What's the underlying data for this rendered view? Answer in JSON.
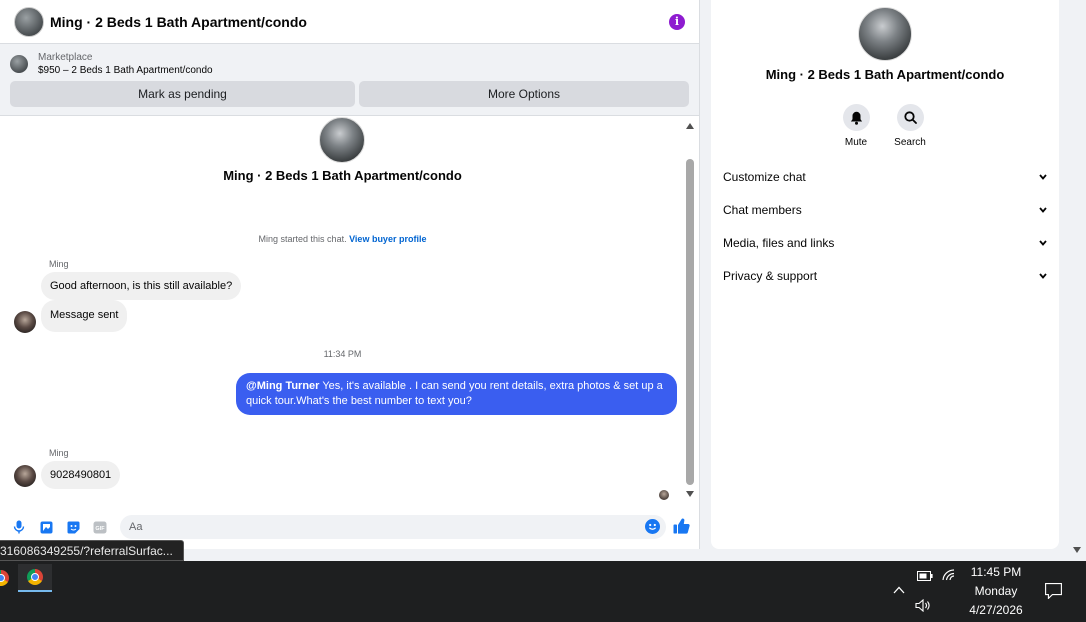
{
  "header": {
    "title": "Ming · 2 Beds 1 Bath Apartment/condo",
    "info_icon": "info-icon"
  },
  "listing": {
    "source": "Marketplace",
    "price_title": "$950 – 2 Beds 1 Bath Apartment/condo",
    "mark_pending": "Mark as pending",
    "more_options": "More Options"
  },
  "thread": {
    "title": "Ming · 2 Beds 1 Bath Apartment/condo",
    "started_text": "Ming started this chat.",
    "view_buyer": "View buyer profile",
    "messages": [
      {
        "sender": "Ming",
        "text": "Good afternoon, is this still available?"
      },
      {
        "sender": "",
        "text": "Message sent"
      },
      {
        "timestamp": "11:34 PM"
      },
      {
        "mention": "@Ming Turner",
        "text": " Yes, it's available .  I can send you rent details, extra photos & set up a quick tour.What's the best number to text you?"
      },
      {
        "sender": "Ming",
        "text": "9028490801"
      }
    ]
  },
  "composer": {
    "placeholder": "Aa",
    "icons": [
      "microphone-icon",
      "image-icon",
      "sticker-icon",
      "gif-icon",
      "emoji-icon",
      "thumbs-up-icon"
    ],
    "gif_label": "GIF"
  },
  "status_url": "316086349255/?referralSurfac...",
  "info_panel": {
    "title": "Ming · 2 Beds 1 Bath Apartment/condo",
    "mute": "Mute",
    "search": "Search",
    "sections": [
      "Customize chat",
      "Chat members",
      "Media, files and links",
      "Privacy & support"
    ]
  },
  "taskbar": {
    "time": "11:45 PM",
    "day": "Monday",
    "date": "4/27/2026"
  },
  "colors": {
    "accent": "#3a5ef0",
    "link": "#0064d1",
    "info_purple": "#8e1bd0"
  }
}
